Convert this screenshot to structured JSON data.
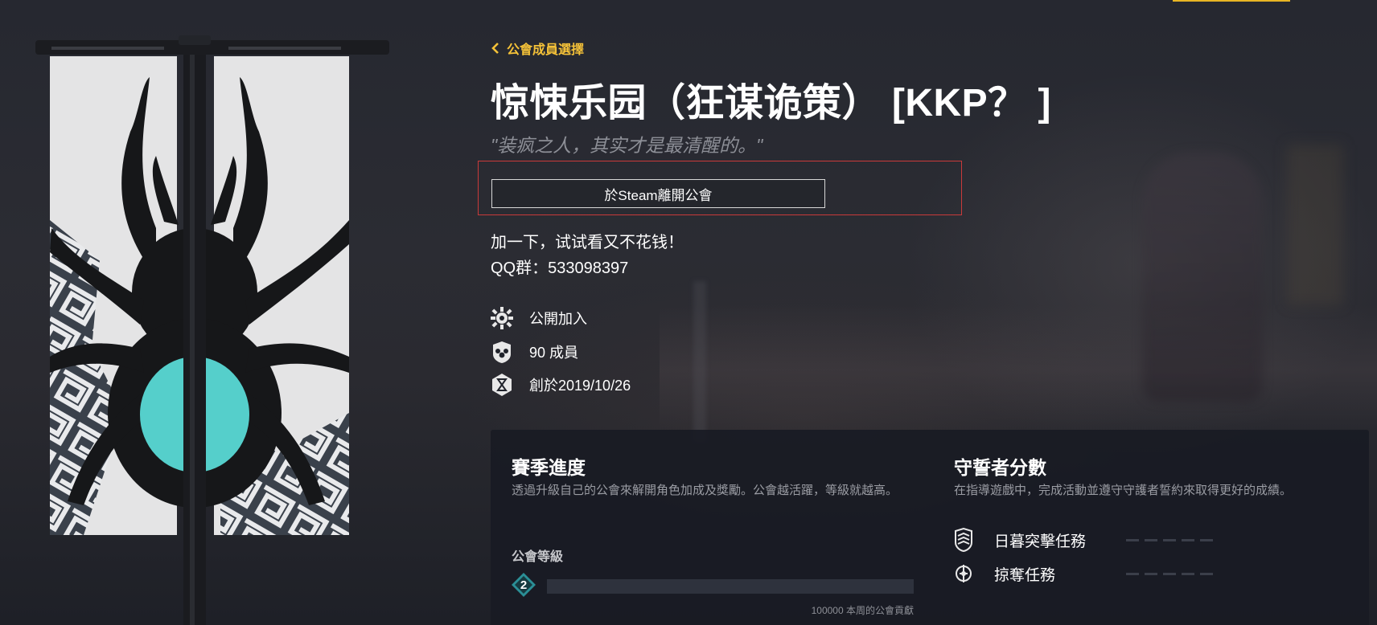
{
  "header": {
    "back_label": "公會成員選擇"
  },
  "clan": {
    "name": "惊悚乐园（狂谋诡策）  [KKP？ ]",
    "motto": "\"装疯之人，其实才是最清醒的。\"",
    "leave_button_label": "於Steam離開公會",
    "description": [
      "加一下，试试看又不花钱！",
      "QQ群：533098397"
    ],
    "meta": [
      {
        "icon": "open-join-icon",
        "text": "公開加入"
      },
      {
        "icon": "members-icon",
        "text": "90 成員"
      },
      {
        "icon": "founded-icon",
        "text": "創於2019/10/26"
      }
    ]
  },
  "season": {
    "title": "賽季進度",
    "description": "透過升級自己的公會來解開角色加成及獎勵。公會越活躍，等級就越高。",
    "level_label": "公會等級",
    "level": "2",
    "progress": 0,
    "contribution_text": "100000 本周的公會貢獻"
  },
  "guardian": {
    "title": "守誓者分數",
    "description": "在指導遊戲中，完成活動並遵守守護者誓約來取得更好的成績。",
    "activities": [
      {
        "icon": "nightfall-strike-icon",
        "label": "日暮突擊任務",
        "slots": 5
      },
      {
        "icon": "raid-icon",
        "label": "掠奪任務",
        "slots": 5
      }
    ]
  },
  "colors": {
    "accent": "#f5c238",
    "highlight_border": "#c93a3a",
    "banner_emblem": "#55cfcb"
  }
}
